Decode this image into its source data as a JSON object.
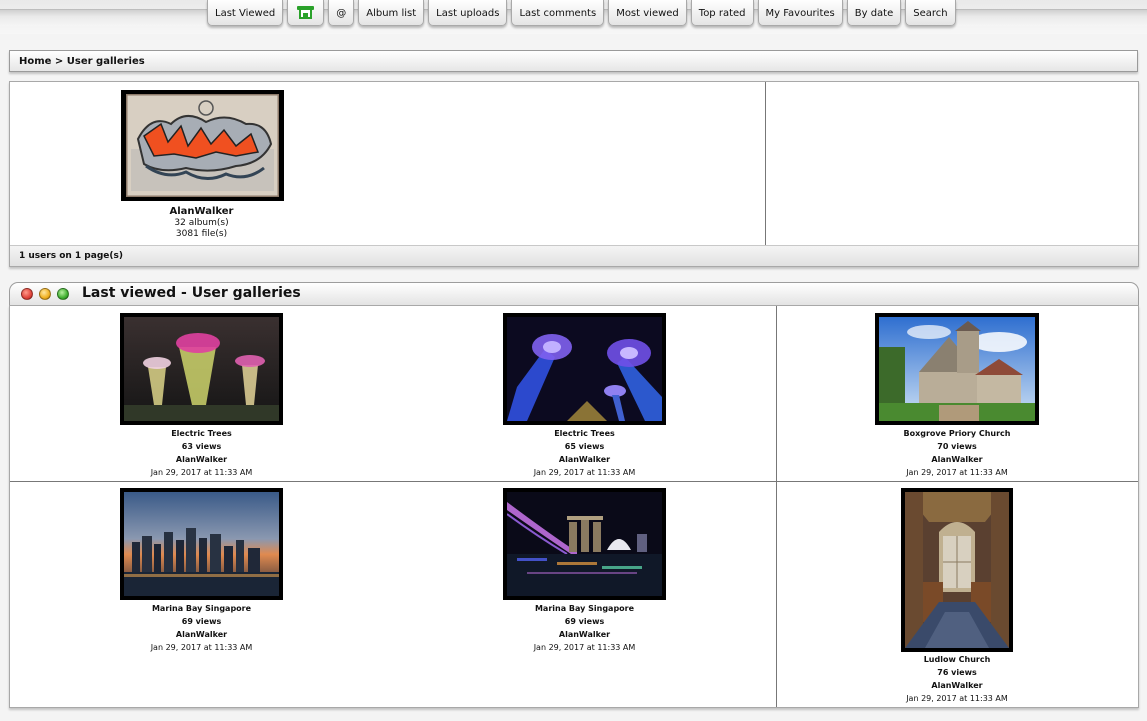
{
  "nav": {
    "tabs": [
      {
        "label": "Last Viewed"
      },
      {
        "label": ""
      },
      {
        "label": "@"
      },
      {
        "label": "Album list"
      },
      {
        "label": "Last uploads"
      },
      {
        "label": "Last comments"
      },
      {
        "label": "Most viewed"
      },
      {
        "label": "Top rated"
      },
      {
        "label": "My Favourites"
      },
      {
        "label": "By date"
      },
      {
        "label": "Search"
      }
    ],
    "home_icon": "home-icon"
  },
  "breadcrumb": {
    "text": "Home > User galleries"
  },
  "users": {
    "items": [
      {
        "name": "AlanWalker",
        "albums": "32 album(s)",
        "files": "3081 file(s)"
      }
    ],
    "footer": "1 users on 1 page(s)"
  },
  "last_viewed": {
    "title": "Last viewed - User galleries",
    "items": [
      {
        "title": "Electric Trees",
        "views": "63 views",
        "owner": "AlanWalker",
        "date": "Jan 29, 2017 at 11:33 AM"
      },
      {
        "title": "Electric Trees",
        "views": "65 views",
        "owner": "AlanWalker",
        "date": "Jan 29, 2017 at 11:33 AM"
      },
      {
        "title": "Boxgrove Priory Church",
        "views": "70 views",
        "owner": "AlanWalker",
        "date": "Jan 29, 2017 at 11:33 AM"
      },
      {
        "title": "Marina Bay Singapore",
        "views": "69 views",
        "owner": "AlanWalker",
        "date": "Jan 29, 2017 at 11:33 AM"
      },
      {
        "title": "Marina Bay Singapore",
        "views": "69 views",
        "owner": "AlanWalker",
        "date": "Jan 29, 2017 at 11:33 AM"
      },
      {
        "title": "Ludlow Church",
        "views": "76 views",
        "owner": "AlanWalker",
        "date": "Jan 29, 2017 at 11:33 AM"
      }
    ]
  },
  "colors": {
    "accent_green": "#2aa12a",
    "border": "#9a9a9a",
    "divider": "#777777"
  }
}
